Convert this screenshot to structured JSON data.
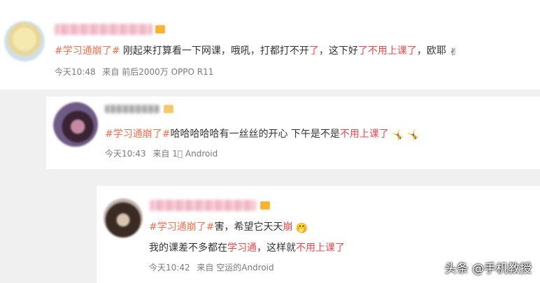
{
  "posts": [
    {
      "topic": "#学习通崩了#",
      "text_a": "刚起来打算看一下网课，哦吼，打都打不开",
      "text_b": "了",
      "text_c": "，这下好",
      "text_d": "了不用上课了",
      "text_e": "，欧耶",
      "emoji": "✌",
      "time": "今天10:48",
      "source": "来自 前后2000万 OPPO R11"
    },
    {
      "topic": "#学习通崩了#",
      "text_a": "哈哈哈哈哈有一丝丝的开心 下午是不是",
      "text_b": "不用上课了",
      "emoji": "🤸 🤸",
      "time": "今天10:43",
      "source": "来自 1⃣ Android"
    },
    {
      "topic": "#学习通崩了#",
      "text_a": "害，希望它天天",
      "text_b": "崩",
      "emoji": "🤭",
      "line2_a": "我的课差不多都在",
      "line2_b": "学习通",
      "line2_c": "，这样就",
      "line2_d": "不用上课了",
      "time": "今天10:42",
      "source": "来自 空运的Android"
    }
  ],
  "watermark": "头条 @手机教授",
  "colors": {
    "topic": "#eb7350",
    "highlight": "#e8484c",
    "meta": "#7a7a7a"
  }
}
